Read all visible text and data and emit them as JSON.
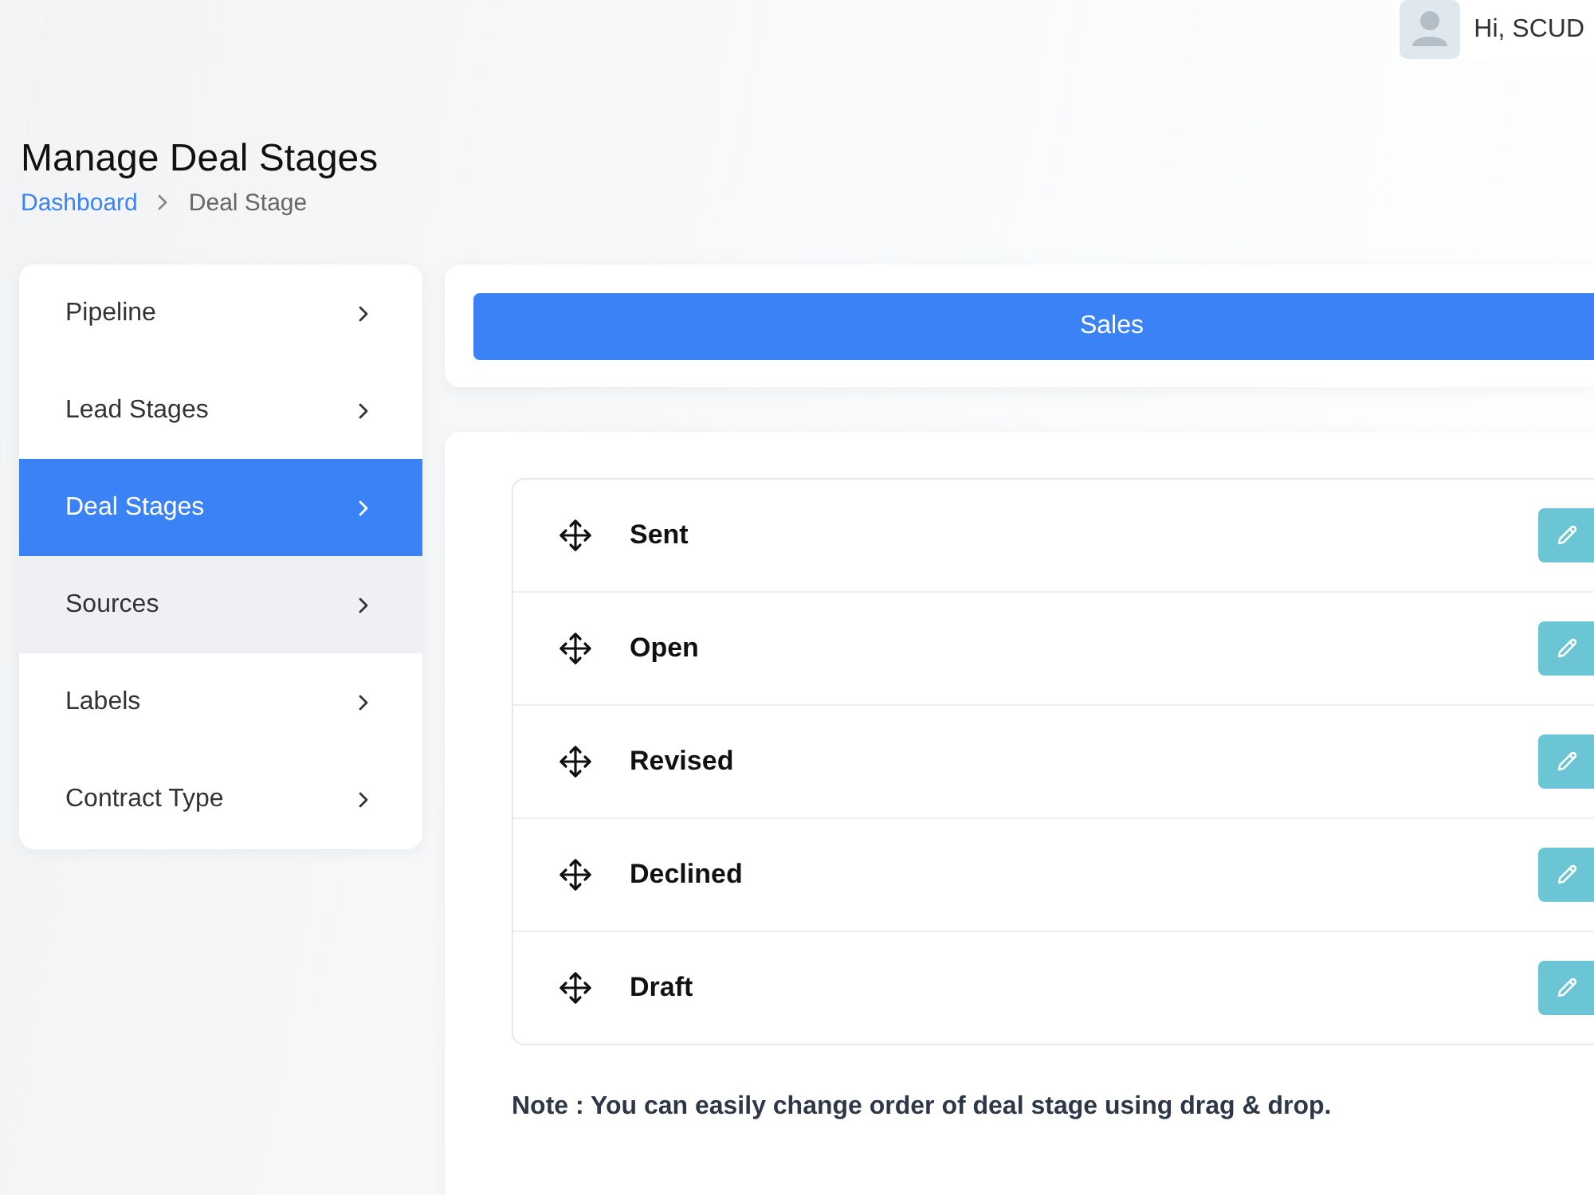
{
  "user_menu": {
    "greeting": "Hi, SCUD"
  },
  "page": {
    "title": "Manage Deal Stages",
    "breadcrumb": [
      {
        "label": "Dashboard",
        "kind": "link"
      },
      {
        "label": "Deal Stage",
        "kind": "current"
      }
    ]
  },
  "sidebar": {
    "items": [
      {
        "label": "Pipeline",
        "selected": false,
        "hovered": false
      },
      {
        "label": "Lead Stages",
        "selected": false,
        "hovered": false
      },
      {
        "label": "Deal Stages",
        "selected": true,
        "hovered": false
      },
      {
        "label": "Sources",
        "selected": false,
        "hovered": true
      },
      {
        "label": "Labels",
        "selected": false,
        "hovered": false
      },
      {
        "label": "Contract Type",
        "selected": false,
        "hovered": false
      }
    ]
  },
  "pipeline_tabs": [
    {
      "label": "Sales",
      "selected": true
    }
  ],
  "stages": [
    {
      "name": "Sent"
    },
    {
      "name": "Open"
    },
    {
      "name": "Revised"
    },
    {
      "name": "Declined"
    },
    {
      "name": "Draft"
    }
  ],
  "note": "Note : You can easily change order of deal stage using drag & drop."
}
